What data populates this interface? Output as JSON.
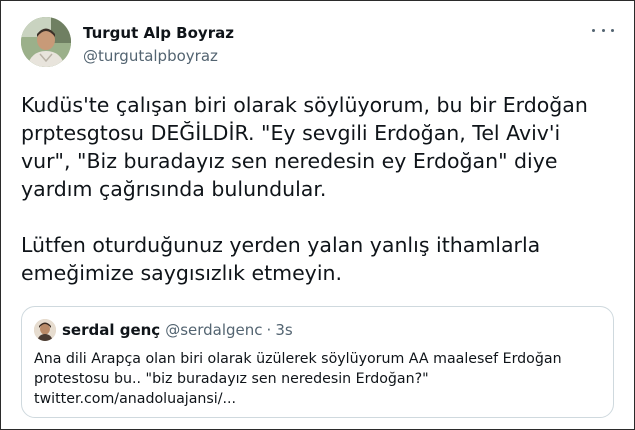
{
  "author": {
    "display_name": "Turgut Alp Boyraz",
    "handle": "@turgutalpboyraz"
  },
  "tweet": {
    "lines_p1": [
      "Kudüs'te çalışan biri olarak söylüyorum, bu bir Erdoğan",
      "prptesgtosu DEĞİLDİR. \"Ey sevgili Erdoğan, Tel Aviv'i",
      "vur\", \"Biz buradayız sen neredesin ey Erdoğan\" diye",
      "yardım çağrısında bulundular."
    ],
    "lines_p2": [
      "Lütfen oturduğunuz yerden yalan yanlış ithamlarla",
      "emeğimize saygısızlık etmeyin."
    ]
  },
  "quote": {
    "display_name": "serdal genç",
    "handle": "@serdalgenc",
    "separator": "·",
    "time": "3s",
    "lines": [
      "Ana dili Arapça olan biri olarak üzülerek söylüyorum AA maalesef Erdoğan",
      "protestosu bu.. \"biz buradayız sen neredesin Erdoğan?\"",
      "twitter.com/anadoluajansi/..."
    ]
  },
  "icons": {
    "more": "more-horizontal-icon"
  },
  "colors": {
    "text_primary": "#0f1419",
    "text_secondary": "#536471",
    "border": "#cfd9de"
  }
}
